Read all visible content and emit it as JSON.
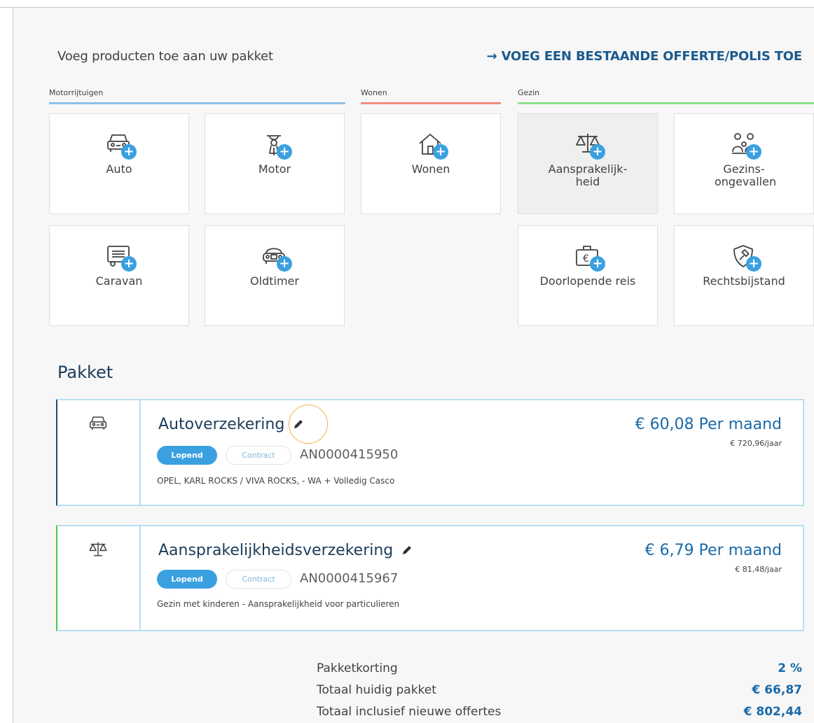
{
  "header": {
    "add_products": "Voeg producten toe aan uw pakket",
    "add_existing_link": "VOEG EEN BESTAANDE OFFERTE/POLIS TOE",
    "arrow": "→"
  },
  "categories": [
    {
      "label": "Motorrijtuigen",
      "color": "#8cc1e8"
    },
    {
      "label": "Wonen",
      "color": "#f08c80"
    },
    {
      "label": "Gezin",
      "color": "#8fe08a"
    }
  ],
  "products": [
    {
      "label": "Auto",
      "icon": "car-icon"
    },
    {
      "label": "Motor",
      "icon": "motorbike-icon"
    },
    {
      "label": "Wonen",
      "icon": "house-icon"
    },
    {
      "label": "Aansprakelijk-heid",
      "icon": "scales-icon",
      "selected": true
    },
    {
      "label": "Gezins-ongevallen",
      "icon": "family-icon"
    },
    {
      "label": "Caravan",
      "icon": "caravan-icon"
    },
    {
      "label": "Oldtimer",
      "icon": "oldtimer-icon"
    },
    {
      "label": "Doorlopende reis",
      "icon": "travel-case-icon"
    },
    {
      "label": "Rechtsbijstand",
      "icon": "shield-hammer-icon"
    }
  ],
  "plus_glyph": "+",
  "pakket": {
    "title": "Pakket",
    "items": [
      {
        "title": "Autoverzekering",
        "status": "Lopend",
        "type": "Contract",
        "policy_number": "AN0000415950",
        "description": "OPEL, KARL ROCKS / VIVA ROCKS, - WA + Volledig Casco",
        "price_month": "€ 60,08 Per maand",
        "price_year": "€ 720,96/jaar",
        "icon": "car-icon",
        "accent": "#1f4a78"
      },
      {
        "title": "Aansprakelijkheidsverzekering",
        "status": "Lopend",
        "type": "Contract",
        "policy_number": "AN0000415967",
        "description": "Gezin met kinderen - Aansprakelijkheid voor particulieren",
        "price_month": "€ 6,79 Per maand",
        "price_year": "€ 81,48/jaar",
        "icon": "scales-icon",
        "accent": "#4ac74a"
      }
    ]
  },
  "summary": [
    {
      "label": "Pakketkorting",
      "value": "2 %"
    },
    {
      "label": "Totaal huidig pakket",
      "value": "€ 66,87"
    },
    {
      "label": "Totaal inclusief nieuwe offertes",
      "value": "€ 802,44"
    }
  ],
  "colors": {
    "accent_blue": "#3aa0e0",
    "link_blue": "#1a5a8f",
    "price_blue": "#1a6aa8"
  }
}
